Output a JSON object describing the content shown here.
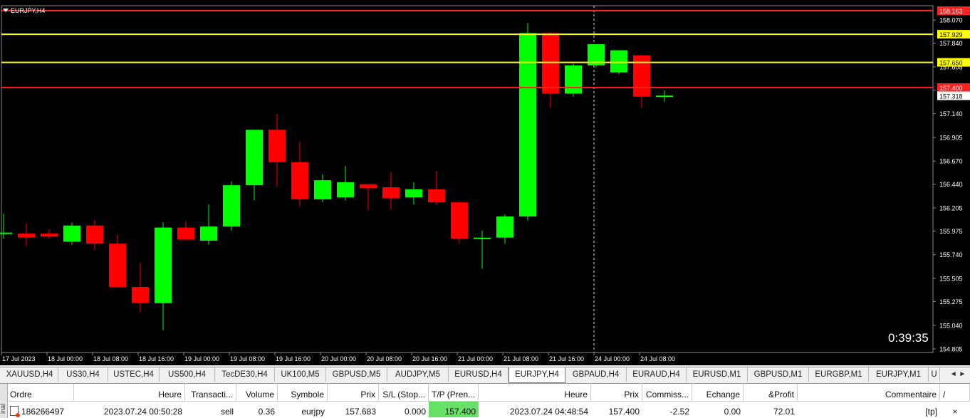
{
  "chart": {
    "symbol_label": "EURJPY,H4",
    "timer": "0:39:35",
    "colors": {
      "background": "#000000",
      "bull": "#00ff00",
      "bear": "#ff0000",
      "axis_text": "#ffffff",
      "support_line": "#ffff00",
      "resist_line": "#ff2020"
    },
    "price_levels": [
      {
        "label": "158.163",
        "value": 158.163,
        "kind": "red"
      },
      {
        "label": "157.929",
        "value": 157.929,
        "kind": "yellow"
      },
      {
        "label": "157.650",
        "value": 157.65,
        "kind": "yellow"
      },
      {
        "label": "157.400",
        "value": 157.4,
        "kind": "red"
      }
    ],
    "current_price": {
      "label": "157.318",
      "value": 157.318
    },
    "y_ticks": [
      "158.070",
      "157.840",
      "157.605",
      "157.375",
      "157.140",
      "156.905",
      "156.670",
      "156.440",
      "156.205",
      "155.975",
      "155.740",
      "155.505",
      "155.275",
      "155.040",
      "154.805"
    ],
    "x_ticks": [
      "17 Jul 2023",
      "18 Jul 00:00",
      "18 Jul 08:00",
      "18 Jul 16:00",
      "19 Jul 00:00",
      "19 Jul 08:00",
      "19 Jul 16:00",
      "20 Jul 00:00",
      "20 Jul 08:00",
      "20 Jul 16:00",
      "21 Jul 00:00",
      "21 Jul 08:00",
      "21 Jul 16:00",
      "24 Jul 00:00",
      "24 Jul 08:00"
    ],
    "candles": [
      {
        "o": 155.96,
        "h": 156.15,
        "l": 155.9,
        "c": 155.96
      },
      {
        "o": 155.95,
        "h": 156.05,
        "l": 155.83,
        "c": 155.91
      },
      {
        "o": 155.95,
        "h": 155.99,
        "l": 155.9,
        "c": 155.92
      },
      {
        "o": 155.87,
        "h": 156.06,
        "l": 155.84,
        "c": 156.03
      },
      {
        "o": 156.03,
        "h": 156.08,
        "l": 155.79,
        "c": 155.85
      },
      {
        "o": 155.85,
        "h": 155.94,
        "l": 155.43,
        "c": 155.42
      },
      {
        "o": 155.42,
        "h": 155.66,
        "l": 155.17,
        "c": 155.26
      },
      {
        "o": 155.26,
        "h": 156.06,
        "l": 154.99,
        "c": 156.01
      },
      {
        "o": 156.01,
        "h": 156.07,
        "l": 155.89,
        "c": 155.89
      },
      {
        "o": 155.88,
        "h": 156.24,
        "l": 155.84,
        "c": 156.02
      },
      {
        "o": 156.02,
        "h": 156.47,
        "l": 155.98,
        "c": 156.43
      },
      {
        "o": 156.43,
        "h": 156.91,
        "l": 156.28,
        "c": 156.98
      },
      {
        "o": 156.98,
        "h": 157.14,
        "l": 156.42,
        "c": 156.66
      },
      {
        "o": 156.66,
        "h": 156.86,
        "l": 156.22,
        "c": 156.29
      },
      {
        "o": 156.29,
        "h": 156.54,
        "l": 156.26,
        "c": 156.48
      },
      {
        "o": 156.31,
        "h": 156.62,
        "l": 156.28,
        "c": 156.46
      },
      {
        "o": 156.44,
        "h": 156.44,
        "l": 156.18,
        "c": 156.4
      },
      {
        "o": 156.41,
        "h": 156.56,
        "l": 156.19,
        "c": 156.3
      },
      {
        "o": 156.31,
        "h": 156.46,
        "l": 156.24,
        "c": 156.39
      },
      {
        "o": 156.39,
        "h": 156.57,
        "l": 156.23,
        "c": 156.26
      },
      {
        "o": 156.26,
        "h": 156.27,
        "l": 155.86,
        "c": 155.9
      },
      {
        "o": 155.9,
        "h": 155.98,
        "l": 155.6,
        "c": 155.91
      },
      {
        "o": 155.91,
        "h": 156.14,
        "l": 155.85,
        "c": 156.12
      },
      {
        "o": 156.12,
        "h": 158.04,
        "l": 156.08,
        "c": 157.94
      },
      {
        "o": 157.94,
        "h": 157.95,
        "l": 157.2,
        "c": 157.34
      },
      {
        "o": 157.34,
        "h": 157.64,
        "l": 157.31,
        "c": 157.62
      },
      {
        "o": 157.62,
        "h": 157.78,
        "l": 157.6,
        "c": 157.83
      },
      {
        "o": 157.55,
        "h": 157.74,
        "l": 157.53,
        "c": 157.77
      },
      {
        "o": 157.72,
        "h": 157.73,
        "l": 157.2,
        "c": 157.31
      },
      {
        "o": 157.31,
        "h": 157.37,
        "l": 157.26,
        "c": 157.32
      }
    ]
  },
  "tabs": [
    "XAUUSD,H4",
    "US30,H4",
    "USTEC,H4",
    "US500,H4",
    "TecDE30,H4",
    "UK100,M5",
    "GBPUSD,M5",
    "AUDJPY,M5",
    "EURUSD,H4",
    "EURJPY,H4",
    "GBPAUD,H4",
    "EURAUD,H4",
    "EURUSD,M1",
    "GBPUSD,M1",
    "EURGBP,M1",
    "EURJPY,M1",
    "U"
  ],
  "active_tab": "EURJPY,H4",
  "tab_scroll": "◄ ►",
  "terminal": {
    "side_label": "inal",
    "headers": [
      "Ordre",
      "Heure",
      "Transacti...",
      "Volume",
      "Symbole",
      "Prix",
      "S/L (Stop...",
      "T/P (Pren...",
      "Heure",
      "Prix",
      "Commiss...",
      "Echange",
      "&Profit",
      "Commentaire",
      "/"
    ],
    "row": [
      "186266497",
      "2023.07.24 00:50:28",
      "sell",
      "0.36",
      "eurjpy",
      "157.683",
      "0.000",
      "157.400",
      "2023.07.24 04:48:54",
      "157.400",
      "-2.52",
      "0.00",
      "72.01",
      "[tp]",
      "×"
    ]
  }
}
